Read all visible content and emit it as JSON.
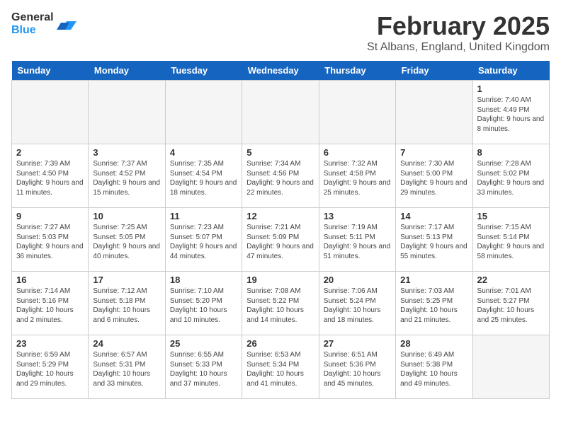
{
  "header": {
    "logo_general": "General",
    "logo_blue": "Blue",
    "title": "February 2025",
    "subtitle": "St Albans, England, United Kingdom"
  },
  "days_of_week": [
    "Sunday",
    "Monday",
    "Tuesday",
    "Wednesday",
    "Thursday",
    "Friday",
    "Saturday"
  ],
  "weeks": [
    [
      {
        "day": "",
        "info": ""
      },
      {
        "day": "",
        "info": ""
      },
      {
        "day": "",
        "info": ""
      },
      {
        "day": "",
        "info": ""
      },
      {
        "day": "",
        "info": ""
      },
      {
        "day": "",
        "info": ""
      },
      {
        "day": "1",
        "info": "Sunrise: 7:40 AM\nSunset: 4:49 PM\nDaylight: 9 hours and 8 minutes."
      }
    ],
    [
      {
        "day": "2",
        "info": "Sunrise: 7:39 AM\nSunset: 4:50 PM\nDaylight: 9 hours and 11 minutes."
      },
      {
        "day": "3",
        "info": "Sunrise: 7:37 AM\nSunset: 4:52 PM\nDaylight: 9 hours and 15 minutes."
      },
      {
        "day": "4",
        "info": "Sunrise: 7:35 AM\nSunset: 4:54 PM\nDaylight: 9 hours and 18 minutes."
      },
      {
        "day": "5",
        "info": "Sunrise: 7:34 AM\nSunset: 4:56 PM\nDaylight: 9 hours and 22 minutes."
      },
      {
        "day": "6",
        "info": "Sunrise: 7:32 AM\nSunset: 4:58 PM\nDaylight: 9 hours and 25 minutes."
      },
      {
        "day": "7",
        "info": "Sunrise: 7:30 AM\nSunset: 5:00 PM\nDaylight: 9 hours and 29 minutes."
      },
      {
        "day": "8",
        "info": "Sunrise: 7:28 AM\nSunset: 5:02 PM\nDaylight: 9 hours and 33 minutes."
      }
    ],
    [
      {
        "day": "9",
        "info": "Sunrise: 7:27 AM\nSunset: 5:03 PM\nDaylight: 9 hours and 36 minutes."
      },
      {
        "day": "10",
        "info": "Sunrise: 7:25 AM\nSunset: 5:05 PM\nDaylight: 9 hours and 40 minutes."
      },
      {
        "day": "11",
        "info": "Sunrise: 7:23 AM\nSunset: 5:07 PM\nDaylight: 9 hours and 44 minutes."
      },
      {
        "day": "12",
        "info": "Sunrise: 7:21 AM\nSunset: 5:09 PM\nDaylight: 9 hours and 47 minutes."
      },
      {
        "day": "13",
        "info": "Sunrise: 7:19 AM\nSunset: 5:11 PM\nDaylight: 9 hours and 51 minutes."
      },
      {
        "day": "14",
        "info": "Sunrise: 7:17 AM\nSunset: 5:13 PM\nDaylight: 9 hours and 55 minutes."
      },
      {
        "day": "15",
        "info": "Sunrise: 7:15 AM\nSunset: 5:14 PM\nDaylight: 9 hours and 58 minutes."
      }
    ],
    [
      {
        "day": "16",
        "info": "Sunrise: 7:14 AM\nSunset: 5:16 PM\nDaylight: 10 hours and 2 minutes."
      },
      {
        "day": "17",
        "info": "Sunrise: 7:12 AM\nSunset: 5:18 PM\nDaylight: 10 hours and 6 minutes."
      },
      {
        "day": "18",
        "info": "Sunrise: 7:10 AM\nSunset: 5:20 PM\nDaylight: 10 hours and 10 minutes."
      },
      {
        "day": "19",
        "info": "Sunrise: 7:08 AM\nSunset: 5:22 PM\nDaylight: 10 hours and 14 minutes."
      },
      {
        "day": "20",
        "info": "Sunrise: 7:06 AM\nSunset: 5:24 PM\nDaylight: 10 hours and 18 minutes."
      },
      {
        "day": "21",
        "info": "Sunrise: 7:03 AM\nSunset: 5:25 PM\nDaylight: 10 hours and 21 minutes."
      },
      {
        "day": "22",
        "info": "Sunrise: 7:01 AM\nSunset: 5:27 PM\nDaylight: 10 hours and 25 minutes."
      }
    ],
    [
      {
        "day": "23",
        "info": "Sunrise: 6:59 AM\nSunset: 5:29 PM\nDaylight: 10 hours and 29 minutes."
      },
      {
        "day": "24",
        "info": "Sunrise: 6:57 AM\nSunset: 5:31 PM\nDaylight: 10 hours and 33 minutes."
      },
      {
        "day": "25",
        "info": "Sunrise: 6:55 AM\nSunset: 5:33 PM\nDaylight: 10 hours and 37 minutes."
      },
      {
        "day": "26",
        "info": "Sunrise: 6:53 AM\nSunset: 5:34 PM\nDaylight: 10 hours and 41 minutes."
      },
      {
        "day": "27",
        "info": "Sunrise: 6:51 AM\nSunset: 5:36 PM\nDaylight: 10 hours and 45 minutes."
      },
      {
        "day": "28",
        "info": "Sunrise: 6:49 AM\nSunset: 5:38 PM\nDaylight: 10 hours and 49 minutes."
      },
      {
        "day": "",
        "info": ""
      }
    ]
  ]
}
